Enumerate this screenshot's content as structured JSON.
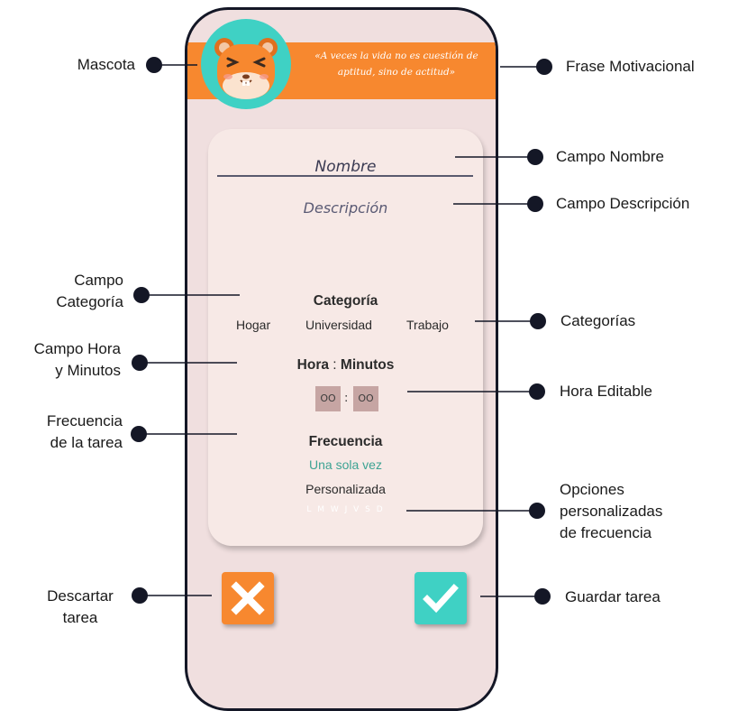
{
  "app": {
    "quote": "«A veces la vida no es cuestión de aptitud, sino de actitud»",
    "name_placeholder": "Nombre",
    "description_placeholder": "Descripción",
    "category_heading": "Categoría",
    "categories": [
      "Hogar",
      "Universidad",
      "Trabajo"
    ],
    "time_heading_hour": "Hora",
    "time_heading_sep": ":",
    "time_heading_minutes": "Minutos",
    "hour_value": "OO",
    "minutes_value": "OO",
    "time_separator": ":",
    "frequency_heading": "Frecuencia",
    "frequency_once": "Una sola vez",
    "frequency_custom": "Personalizada",
    "weekdays": "L M W J V S D"
  },
  "annotations": {
    "mascota": "Mascota",
    "frase": "Frase Motivacional",
    "campo_nombre": "Campo Nombre",
    "campo_descripcion": "Campo Descripción",
    "campo_categoria_1": "Campo",
    "campo_categoria_2": "Categoría",
    "categorias": "Categorías",
    "campo_hora_1": "Campo Hora",
    "campo_hora_2": "y Minutos",
    "hora_editable": "Hora Editable",
    "frecuencia_1": "Frecuencia",
    "frecuencia_2": "de la tarea",
    "opciones_1": "Opciones",
    "opciones_2": "personalizadas",
    "opciones_3": "de frecuencia",
    "descartar_1": "Descartar",
    "descartar_2": "tarea",
    "guardar": "Guardar tarea"
  },
  "colors": {
    "orange": "#f7882f",
    "teal": "#3fd1c4",
    "phone_bg": "#f0dfdf",
    "card_bg": "#f7e9e6",
    "time_box": "#c6a5a3",
    "once_text": "#3da393"
  },
  "icons": [
    "hamster-mascot-icon",
    "close-icon",
    "check-icon"
  ]
}
